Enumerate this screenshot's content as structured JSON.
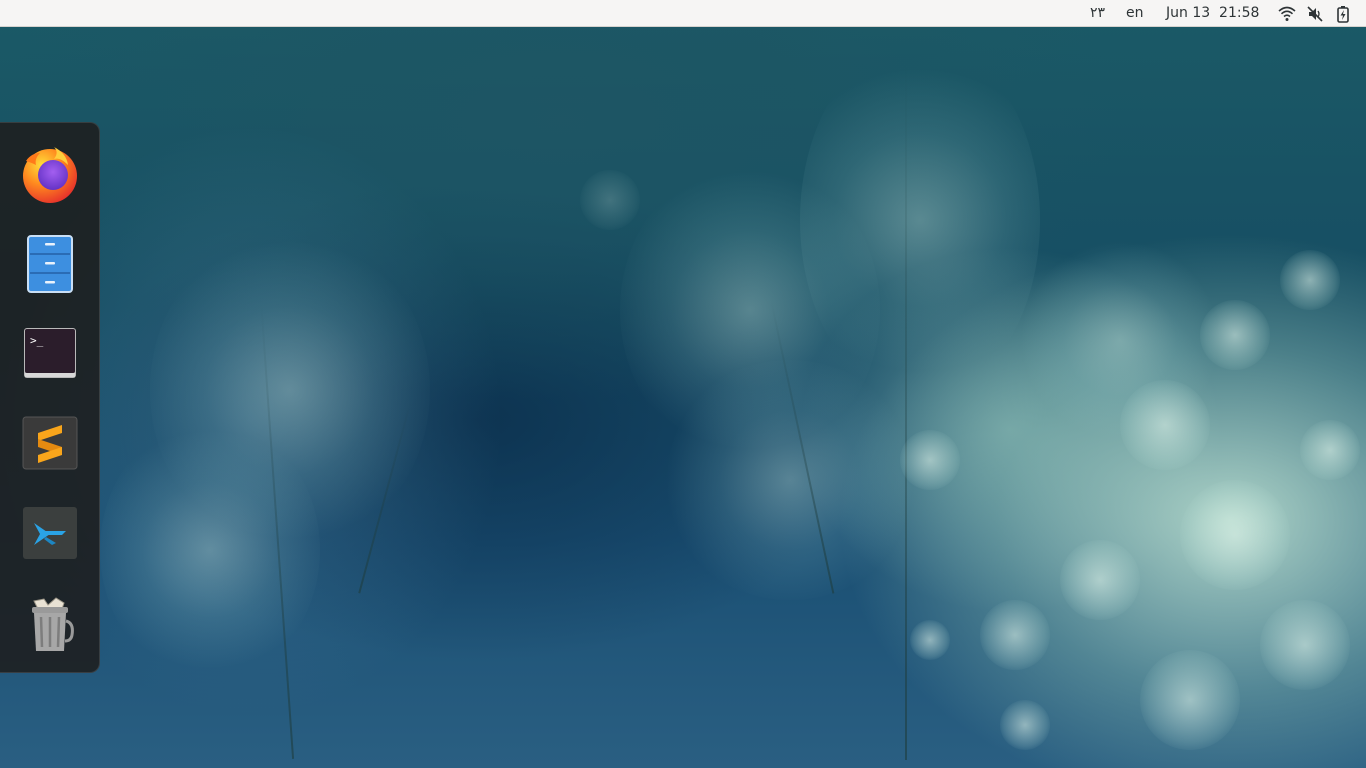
{
  "topbar": {
    "indicator_text": "۲۳",
    "keyboard_layout": "en",
    "date": "Jun 13",
    "time": "21:58",
    "status_icons": [
      "wifi-icon",
      "volume-muted-icon",
      "battery-charging-icon"
    ]
  },
  "dock": {
    "items": [
      {
        "icon": "firefox-icon",
        "app": "Firefox"
      },
      {
        "icon": "files-icon",
        "app": "Files"
      },
      {
        "icon": "terminal-icon",
        "app": "Terminal",
        "prompt": ">_"
      },
      {
        "icon": "sublime-text-icon",
        "app": "Sublime Text"
      },
      {
        "icon": "remmina-icon",
        "app": "Remmina"
      },
      {
        "icon": "trash-icon",
        "app": "Trash"
      }
    ]
  },
  "colors": {
    "topbar_bg": "#f6f5f4",
    "dock_bg": "#1e1e1e",
    "files_blue": "#3d8fe0",
    "remmina_blue": "#2aa3e5",
    "sublime_orange": "#f9a51b"
  },
  "wallpaper": {
    "theme": "frosted-plants-teal"
  }
}
